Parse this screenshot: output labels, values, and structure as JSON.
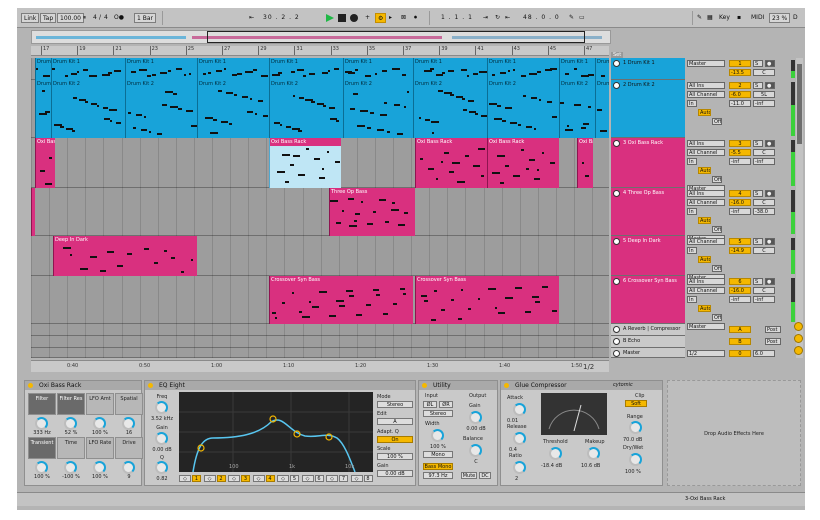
{
  "control_bar": {
    "link": "Link",
    "tap": "Tap",
    "tempo": "100.00",
    "meter_num": "4",
    "meter_sep": "/",
    "meter_den": "4",
    "metronome": "O●",
    "quantize": "1 Bar",
    "position": "30 .  2 .  2",
    "loop_start": "1 .  1 .  1",
    "loop_length": "48 .  0 .  0",
    "key": "Key",
    "midi": "MIDI",
    "cpu": "23 %",
    "cpu_letter": "D"
  },
  "ruler_ticks": [
    "17",
    "19",
    "21",
    "23",
    "25",
    "27",
    "29",
    "31",
    "33",
    "35",
    "37",
    "39",
    "41",
    "43",
    "45",
    "47"
  ],
  "bottom_ruler": [
    "0:40",
    "0:50",
    "1:00",
    "1:10",
    "1:20",
    "1:30",
    "1:40",
    "1:50"
  ],
  "set_label": "Set",
  "zoom_ratio": "1/2",
  "tracks": [
    {
      "num": "1",
      "name": "Drum Kit 1",
      "color": "blue",
      "routing": [
        "Master"
      ],
      "vol": "-13.5",
      "pan": "C",
      "arm": "1"
    },
    {
      "num": "2",
      "name": "Drum Kit 2",
      "color": "blue",
      "routing": [
        "All Ins",
        "All Channel",
        "In",
        "Auto",
        "Off"
      ],
      "vol": "-6.0",
      "pan": "5L",
      "send1": "-11.0",
      "send2": "-inf",
      "arm": "2"
    },
    {
      "num": "3",
      "name": "Oxi Bass Rack",
      "color": "pink",
      "routing": [
        "All Ins",
        "All Channel",
        "In",
        "Auto",
        "Off",
        "Master"
      ],
      "vol": "-5.5",
      "pan": "C",
      "send1": "-inf",
      "send2": "-inf",
      "arm": "3"
    },
    {
      "num": "4",
      "name": "Three Op Bass",
      "color": "pink",
      "routing": [
        "All Ins",
        "All Channel",
        "In",
        "Auto",
        "Off",
        "Master"
      ],
      "vol": "-16.0",
      "pan": "C",
      "send1": "-inf",
      "send2": "-38.0",
      "arm": "4"
    },
    {
      "num": "5",
      "name": "Deep In Dark",
      "color": "pink",
      "routing": [
        "All Channel",
        "In",
        "Auto",
        "Off",
        "Master"
      ],
      "vol": "-14.9",
      "pan": "C",
      "arm": "5"
    },
    {
      "num": "6",
      "name": "Crossover Syn Bass",
      "color": "pink",
      "routing": [
        "All Ins",
        "All Channel",
        "In",
        "Auto",
        "Off",
        "Master"
      ],
      "vol": "-16.0",
      "pan": "C",
      "send1": "-inf",
      "send2": "-inf",
      "arm": "6"
    }
  ],
  "returns": [
    {
      "name": "A Reverb | Compressor",
      "letter": "A",
      "post": "Post"
    },
    {
      "name": "B Echo",
      "letter": "B",
      "post": "Post"
    },
    {
      "name": "Master",
      "letter": "0",
      "vol": "6.0"
    }
  ],
  "master_routing": "1/2",
  "clips": {
    "t1": [
      "Drum Kit 1",
      "Drum Kit 1",
      "Drum Kit 1",
      "Drum Kit 1",
      "Drum Kit 1",
      "Drum Kit 1",
      "Drum Kit 1",
      "Drum Kit 1",
      "Drum Kit 1",
      "Drum Kit 1",
      "Drum Kit 1"
    ],
    "t2": [
      "Drum Kit 2",
      "Drum Kit 2",
      "Drum Kit 2",
      "Drum Kit 2",
      "Drum Kit 2",
      "Drum Kit 2",
      "Drum Kit 2",
      "Drum Kit 2",
      "Drum Kit 2",
      "Drum Kit 2",
      "Drum Kit 2"
    ],
    "t3": [
      "Oxi Bas",
      "Oxi Bass Rack",
      "Oxi Bass Rack",
      "Oxi Bass Rack",
      "Oxi Bass Rack",
      "Oxi Bass Rack"
    ],
    "t4": [
      "Three Op Bass"
    ],
    "t5": [
      "Deep In Dark"
    ],
    "t6": [
      "Crossover Syn Bass",
      "Crossover Syn Bass"
    ]
  },
  "devices": {
    "rack": {
      "title": "Oxi Bass Rack",
      "macros": [
        {
          "label": "Filter",
          "value": "333 Hz"
        },
        {
          "label": "Filter Res",
          "value": "52 %"
        },
        {
          "label": "LFO Amt",
          "value": "100 %"
        },
        {
          "label": "Spatial",
          "value": "16"
        },
        {
          "label": "Transient",
          "value": "100 %"
        },
        {
          "label": "Time",
          "value": "-100 %"
        },
        {
          "label": "LFO Rate",
          "value": "100 %"
        },
        {
          "label": "Drive",
          "value": "9"
        }
      ]
    },
    "eq": {
      "title": "EQ Eight",
      "freq_label": "Freq",
      "freq": "3.52 kHz",
      "gain_label": "Gain",
      "gain": "0.00 dB",
      "q_label": "Q",
      "q": "0.82",
      "mode_label": "Mode",
      "mode": "Stereo",
      "edit_label": "Edit",
      "edit": "A",
      "adapt_label": "Adapt. Q",
      "adapt": "On",
      "scale_label": "Scale",
      "scale": "100 %",
      "gain_out_label": "Gain",
      "gain_out": "0.00 dB",
      "freq_axis": [
        "100",
        "1k",
        "10k"
      ],
      "bands": [
        "1",
        "2",
        "3",
        "4",
        "5",
        "6",
        "7",
        "8"
      ]
    },
    "utility": {
      "title": "Utility",
      "input": "Input",
      "output": "Output",
      "phase_l": "ØL",
      "phase_r": "ØR",
      "channel": "Stereo",
      "gain_label": "Gain",
      "gain": "0.00 dB",
      "width_label": "Width",
      "width": "100 %",
      "mono": "Mono",
      "balance_label": "Balance",
      "balance": "C",
      "bass_mono": "Bass Mono",
      "bass_freq": "97.3 Hz",
      "mute": "Mute",
      "dc": "DC"
    },
    "glue": {
      "title": "Glue Compressor",
      "brand": "cytomic",
      "attack_label": "Attack",
      "attack": "0.01",
      "ratio_label": "Ratio",
      "ratio": "2",
      "release_label": "Release",
      "release": "0.4",
      "threshold_label": "Threshold",
      "threshold": "-18.4 dB",
      "makeup_label": "Makeup",
      "makeup": "10.6 dB",
      "clip_label": "Clip",
      "soft": "Soft",
      "range_label": "Range",
      "range": "70.0 dB",
      "drywet_label": "Dry/Wet",
      "drywet": "100 %"
    }
  },
  "drop_hint": "Drop Audio Effects Here",
  "status_right": "3-Oxi Bass Rack",
  "colors": {
    "blue": "#18a3d9",
    "pink": "#d9307f",
    "accent": "#f5b800",
    "play": "#1fb846"
  }
}
